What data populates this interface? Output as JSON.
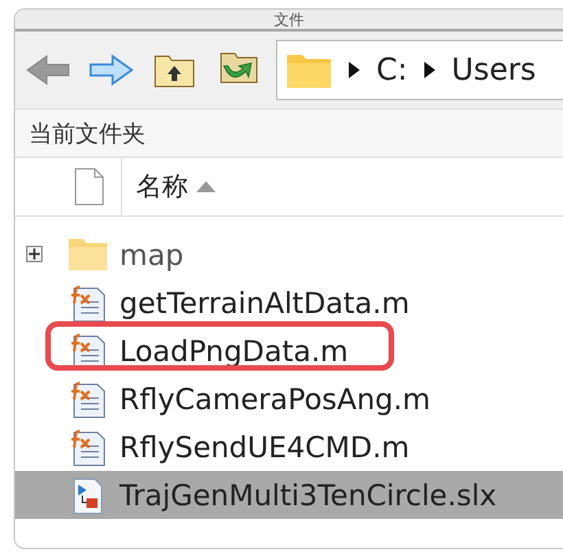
{
  "window": {
    "title": "文件"
  },
  "toolbar": {
    "buttons": [
      {
        "kind": "back",
        "disabled": true
      },
      {
        "kind": "forward",
        "disabled": false
      },
      {
        "kind": "up"
      },
      {
        "kind": "browse"
      }
    ]
  },
  "address": {
    "crumbs": [
      "C:",
      "Users"
    ]
  },
  "panel": {
    "title": "当前文件夹"
  },
  "table": {
    "columns": [
      {
        "label": "名称",
        "sort_ascending": true
      }
    ],
    "rows": [
      {
        "name": "map",
        "kind": "folder",
        "expanded": false,
        "selected": false,
        "highlighted": false
      },
      {
        "name": "getTerrainAltData.m",
        "kind": "mfile",
        "selected": false,
        "highlighted": false
      },
      {
        "name": "LoadPngData.m",
        "kind": "mfile",
        "selected": false,
        "highlighted": true
      },
      {
        "name": "RflyCameraPosAng.m",
        "kind": "mfile",
        "selected": false,
        "highlighted": false
      },
      {
        "name": "RflySendUE4CMD.m",
        "kind": "mfile",
        "selected": false,
        "highlighted": false
      },
      {
        "name": "TrajGenMulti3TenCircle.slx",
        "kind": "model",
        "selected": true,
        "highlighted": false
      }
    ]
  }
}
